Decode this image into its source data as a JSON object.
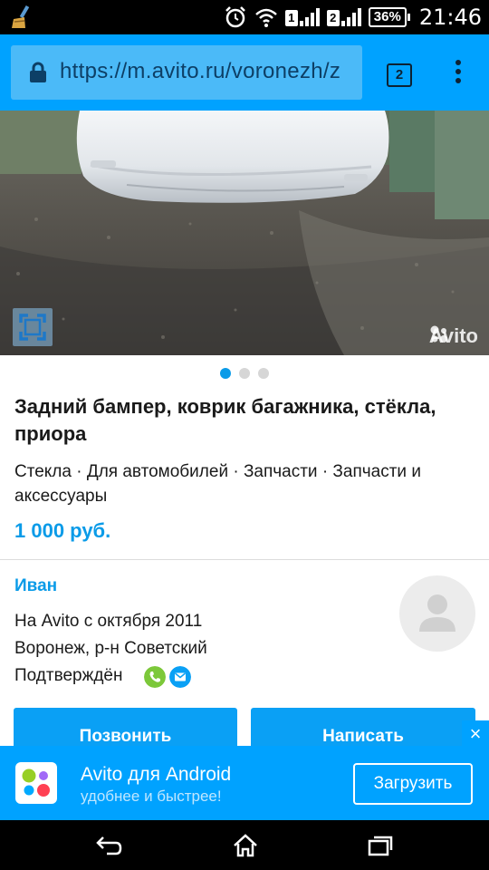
{
  "status_bar": {
    "sim1": "1",
    "sim2": "2",
    "battery": "36%",
    "time": "21:46",
    "icons": [
      "broom-icon",
      "alarm-icon",
      "wifi-icon",
      "signal-icon",
      "battery-icon"
    ]
  },
  "browser": {
    "url": "https://m.avito.ru/voronezh/z",
    "tab_count": "2"
  },
  "listing": {
    "watermark": "Avito",
    "photo_count": 3,
    "title": "Задний бампер, коврик багажника, стёкла, приора",
    "category": "Стекла · Для автомобилей · Запчасти · Запчасти и аксессуары",
    "price": "1 000 руб."
  },
  "seller": {
    "name": "Иван",
    "since": "На Avito с октября 2011",
    "location": "Воронеж, р-н Советский",
    "verified": "Подтверждён"
  },
  "actions": {
    "call": "Позвонить",
    "write": "Написать"
  },
  "banner": {
    "title": "Avito для Android",
    "subtitle": "удобнее и быстрее!",
    "button": "Загрузить",
    "close": "×"
  },
  "colors": {
    "accent": "#00a2ff",
    "price": "#0a9be8",
    "phone_green": "#7cc83a"
  }
}
